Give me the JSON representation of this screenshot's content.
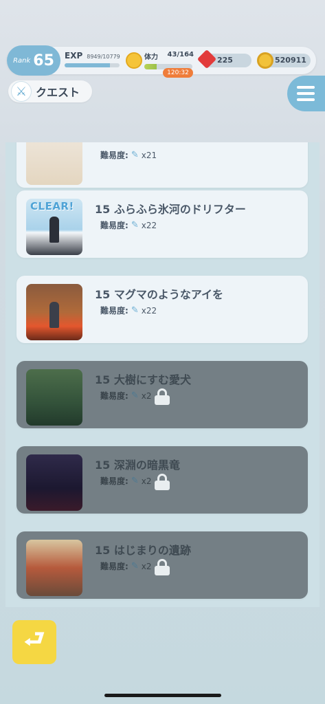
{
  "status": {
    "rank_label": "Rank",
    "rank_value": "65",
    "exp_label": "EXP",
    "exp_value": "8949/10779",
    "exp_progress": 0.83,
    "stamina_label": "体力",
    "stamina_value": "43/164",
    "stamina_progress": 0.26,
    "stamina_timer": "120:32",
    "gems": "225",
    "coins": "520911"
  },
  "tab": {
    "label": "クエスト",
    "icon": "sword-icon"
  },
  "difficulty_label": "難易度:",
  "quests": [
    {
      "title": "",
      "difficulty": "x21",
      "locked": false,
      "partial": true
    },
    {
      "title": "15 ふらふら氷河のドリフター",
      "difficulty": "x22",
      "locked": false,
      "badge": "CLEAR!"
    },
    {
      "title": "15 マグマのようなアイを",
      "difficulty": "x22",
      "locked": false
    },
    {
      "title": "15 大樹にすむ愛犬",
      "difficulty": "x2",
      "locked": true
    },
    {
      "title": "15 深淵の暗黒竜",
      "difficulty": "x2",
      "locked": true
    },
    {
      "title": "15 はじまりの遺跡",
      "difficulty": "x2",
      "locked": true
    }
  ],
  "icons": {
    "menu": "hamburger-menu-icon",
    "back": "return-arrow-icon",
    "lock": "lock-icon",
    "gem": "red-gem-icon",
    "coin": "gold-coin-icon"
  },
  "colors": {
    "accent": "#7cbad8",
    "back_button": "#f5d743",
    "timer": "#ef7d3a"
  }
}
